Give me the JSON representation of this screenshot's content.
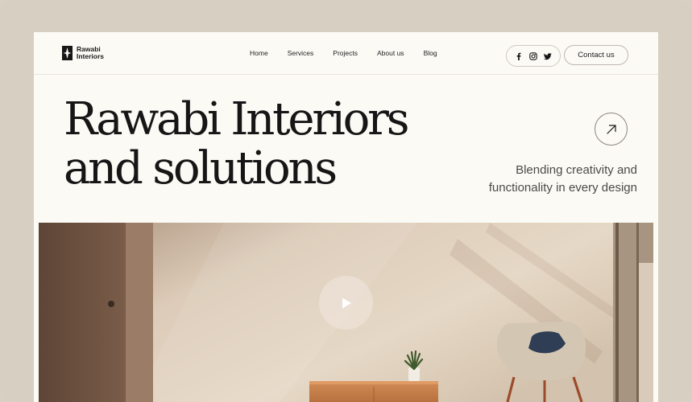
{
  "brand": {
    "name_line1": "Rawabi",
    "name_line2": "Interiors"
  },
  "nav": {
    "items": [
      {
        "label": "Home"
      },
      {
        "label": "Services"
      },
      {
        "label": "Projects"
      },
      {
        "label": "About us"
      },
      {
        "label": "Blog"
      }
    ],
    "social_icons": [
      "facebook-icon",
      "instagram-icon",
      "twitter-icon"
    ],
    "contact_label": "Contact us"
  },
  "hero": {
    "title_line1": "Rawabi Interiors",
    "title_line2": "and solutions",
    "tagline_line1": "Blending creativity and",
    "tagline_line2": "functionality in every design",
    "arrow_icon": "arrow-up-right-icon"
  },
  "media": {
    "play_icon": "play-icon"
  },
  "colors": {
    "background": "#d8cfc3",
    "page": "#fcfaf5",
    "text": "#161616",
    "wall": "#e8ddd0",
    "wood": "#c98a55"
  }
}
